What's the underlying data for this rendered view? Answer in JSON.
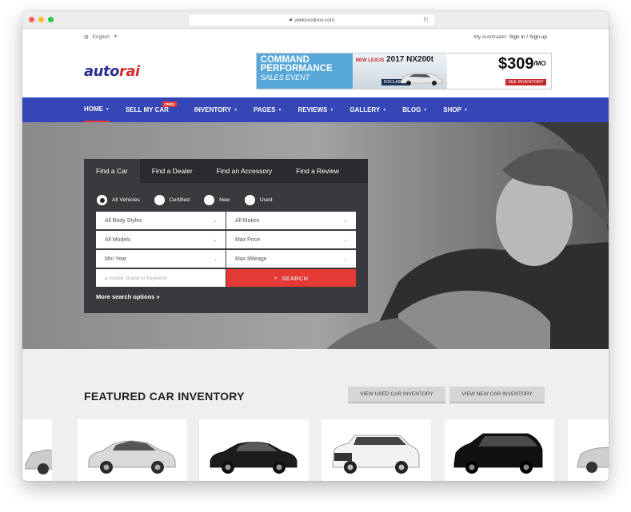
{
  "browser": {
    "url": "velikorodnov.com"
  },
  "topbar": {
    "language": "English",
    "account_prefix": "My Autotrader:",
    "account_links": "Sign in / Sign up"
  },
  "logo": {
    "part1": "auto",
    "part2": "rai"
  },
  "ad": {
    "headline1": "COMMAND",
    "headline2": "PERFORMANCE",
    "headline3": "SALES EVENT",
    "model_prefix": "NEW LEXUS",
    "model": "2017 NX200t",
    "disclaimer": "DISCLAIMER",
    "price": "$309",
    "price_sub": "/MO",
    "cta": "SEE INVENTORY"
  },
  "nav": {
    "items": [
      {
        "label": "HOME",
        "active": true
      },
      {
        "label": "SELL MY CAR",
        "badge": "FREE"
      },
      {
        "label": "INVENTORY"
      },
      {
        "label": "PAGES"
      },
      {
        "label": "REVIEWS"
      },
      {
        "label": "GALLERY"
      },
      {
        "label": "BLOG"
      },
      {
        "label": "SHOP"
      }
    ]
  },
  "search_panel": {
    "tabs": [
      "Find a Car",
      "Find a Dealer",
      "Find an Accessory",
      "Find a Review"
    ],
    "radios": [
      {
        "label": "All Vehicles",
        "checked": true
      },
      {
        "label": "Certified",
        "checked": false
      },
      {
        "label": "New",
        "checked": false
      },
      {
        "label": "Used",
        "checked": false
      }
    ],
    "selects": [
      "All Body Styles",
      "All Makes",
      "All Models",
      "Max Price",
      "Min Year",
      "Max Mileage"
    ],
    "keyword_placeholder": "a model, brand or keyword",
    "search_button": "SEARCH",
    "more_options": "More search options"
  },
  "featured": {
    "title": "FEATURED CAR INVENTORY",
    "btn_used": "VIEW USED CAR INVENTORY",
    "btn_new": "VIEW NEW CAR INVENTORY"
  },
  "colors": {
    "nav": "#3546b6",
    "accent": "#e53935",
    "panel": "#3a3a3e",
    "logo_blue": "#2a2f8f"
  }
}
